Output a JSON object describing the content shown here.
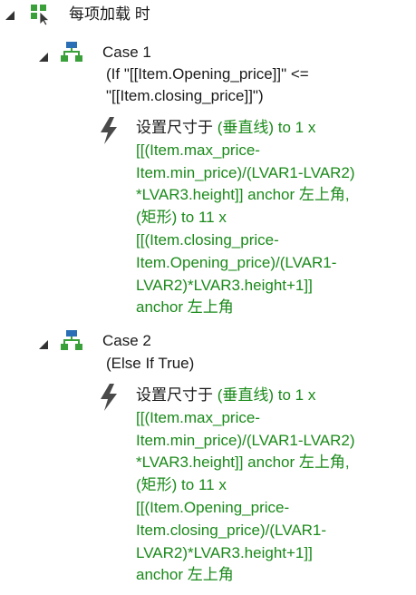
{
  "event": {
    "label": "每项加载 时"
  },
  "cases": [
    {
      "title": "Case 1",
      "condition_lines": [
        "(If \"[[Item.Opening_price]]\" <=",
        "\"[[Item.closing_price]]\")"
      ],
      "action": {
        "lines": [
          [
            {
              "t": "设置尺寸于 ",
              "c": "k"
            },
            {
              "t": "(垂直线)",
              "c": "g"
            },
            {
              "t": " to 1 x",
              "c": "g"
            }
          ],
          [
            {
              "t": "[[(Item.max_price-",
              "c": "g"
            }
          ],
          [
            {
              "t": "Item.min_price)/(LVAR1-LVAR2)",
              "c": "g"
            }
          ],
          [
            {
              "t": "*LVAR3.height]]",
              "c": "g"
            },
            {
              "t": " anchor 左上角,",
              "c": "g"
            }
          ],
          [
            {
              "t": "(矩形)",
              "c": "g"
            },
            {
              "t": " to 11 x",
              "c": "g"
            }
          ],
          [
            {
              "t": "[[(Item.closing_price-",
              "c": "g"
            }
          ],
          [
            {
              "t": "Item.Opening_price)/(LVAR1-",
              "c": "g"
            }
          ],
          [
            {
              "t": "LVAR2)*LVAR3.height+1]]",
              "c": "g"
            }
          ],
          [
            {
              "t": "anchor 左上角",
              "c": "g"
            }
          ]
        ]
      }
    },
    {
      "title": "Case 2",
      "condition_lines": [
        "(Else If True)"
      ],
      "action": {
        "lines": [
          [
            {
              "t": "设置尺寸于 ",
              "c": "k"
            },
            {
              "t": "(垂直线)",
              "c": "g"
            },
            {
              "t": " to 1 x",
              "c": "g"
            }
          ],
          [
            {
              "t": "[[(Item.max_price-",
              "c": "g"
            }
          ],
          [
            {
              "t": "Item.min_price)/(LVAR1-LVAR2)",
              "c": "g"
            }
          ],
          [
            {
              "t": "*LVAR3.height]]",
              "c": "g"
            },
            {
              "t": " anchor 左上角,",
              "c": "g"
            }
          ],
          [
            {
              "t": "(矩形)",
              "c": "g"
            },
            {
              "t": " to 11 x",
              "c": "g"
            }
          ],
          [
            {
              "t": "[[(Item.Opening_price-",
              "c": "g"
            }
          ],
          [
            {
              "t": "Item.closing_price)/(LVAR1-",
              "c": "g"
            }
          ],
          [
            {
              "t": "LVAR2)*LVAR3.height+1]]",
              "c": "g"
            }
          ],
          [
            {
              "t": "anchor 左上角",
              "c": "g"
            }
          ]
        ]
      }
    }
  ],
  "icons": {
    "event": "event-cursor-icon",
    "case": "case-branch-icon",
    "action": "action-lightning-icon"
  },
  "colors": {
    "accent_green": "#1a8a1a",
    "text": "#1a1a1a",
    "icon_blue": "#2a6fb5"
  }
}
